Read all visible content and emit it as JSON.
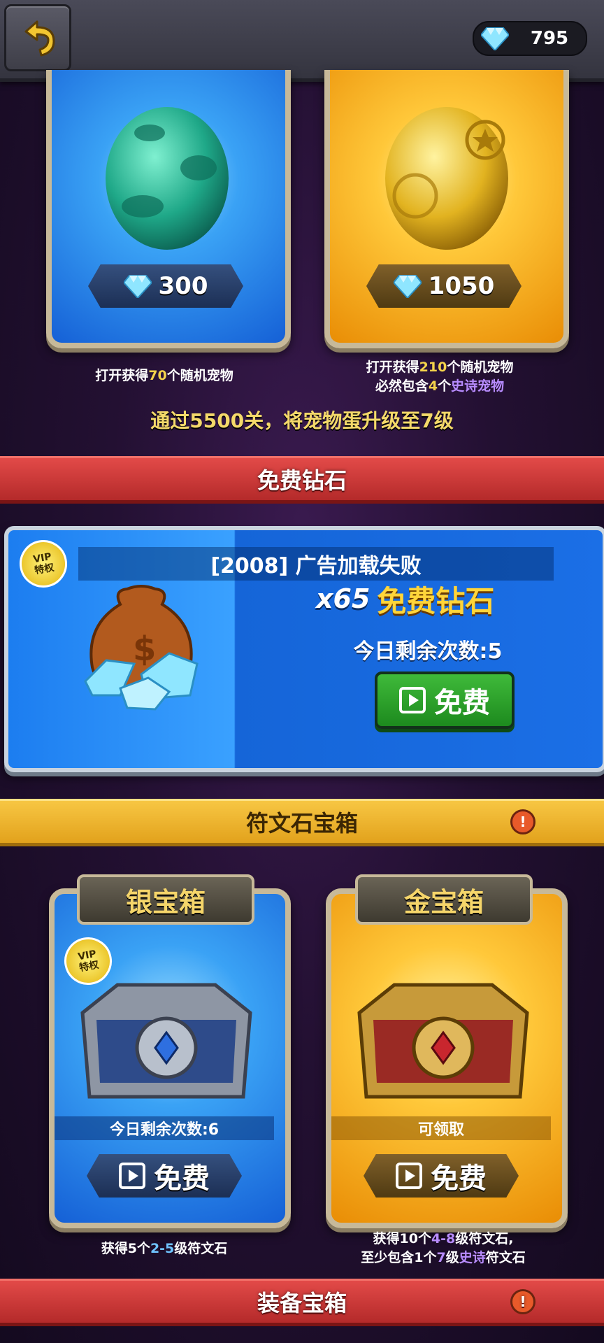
{
  "header": {
    "gem_count": "795",
    "back_icon": "undo-arrow-icon"
  },
  "eggs": [
    {
      "price": "300",
      "desc_parts": [
        "打开获得",
        "70",
        "个随机宠物"
      ],
      "color": "#3aa2f5"
    },
    {
      "price": "1050",
      "desc_line1_parts": [
        "打开获得",
        "210",
        "个随机宠物"
      ],
      "desc_line2_parts": [
        "必然包含",
        "4",
        "个",
        "史诗宠物"
      ],
      "color": "#ffc83a"
    }
  ],
  "upgrade_notice": "通过5500关，将宠物蛋升级至7级",
  "free_gems": {
    "banner": "免费钻石",
    "vip_line1": "VIP",
    "vip_line2": "特权",
    "ad_error": "[2008] 广告加载失败",
    "reward_qty": "x65",
    "reward_label": "免费钻石",
    "remaining": "今日剩余次数:5",
    "button": "免费"
  },
  "rune_chests": {
    "banner": "符文石宝箱",
    "silver": {
      "title": "银宝箱",
      "vip_line1": "VIP",
      "vip_line2": "特权",
      "status": "今日剩余次数:6",
      "button": "免费",
      "desc_parts": [
        "获得5个",
        "2-5",
        "级符文石"
      ]
    },
    "gold": {
      "title": "金宝箱",
      "status": "可领取",
      "button": "免费",
      "desc_line1_parts": [
        "获得10个",
        "4-8",
        "级符文石,"
      ],
      "desc_line2_parts": [
        "至少包含1个",
        "7",
        "级",
        "史诗",
        "符文石"
      ]
    }
  },
  "equip_chests": {
    "banner": "装备宝箱"
  }
}
